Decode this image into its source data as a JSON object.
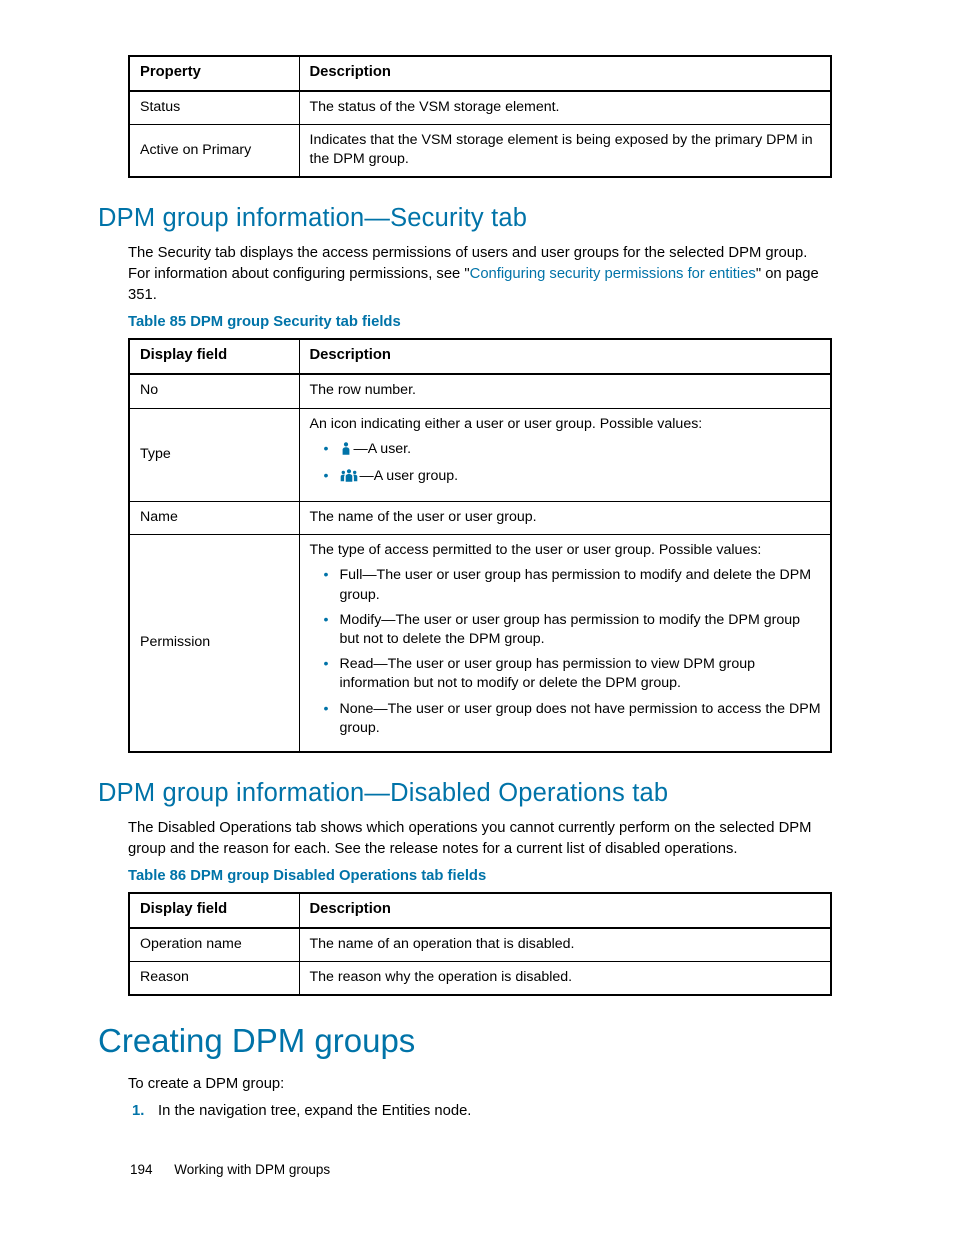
{
  "table1": {
    "headers": [
      "Property",
      "Description"
    ],
    "rows": [
      {
        "k": "Status",
        "v": "The status of the VSM storage element."
      },
      {
        "k": "Active on Primary",
        "v": "Indicates that the VSM storage element is being exposed by the primary DPM in the DPM group."
      }
    ]
  },
  "sec1": {
    "title": "DPM group information—Security tab",
    "intro_a": "The Security tab displays the access permissions of users and user groups for the selected DPM group. For information about configuring permissions, see \"",
    "link": "Configuring security permissions for entities",
    "intro_b": "\" on page 351.",
    "caption": "Table 85 DPM group Security tab fields"
  },
  "table2": {
    "headers": [
      "Display field",
      "Description"
    ],
    "row_no": {
      "k": "No",
      "v": "The row number."
    },
    "row_type": {
      "k": "Type",
      "lead": "An icon indicating either a user or user group. Possible values:",
      "li_user": "—A user.",
      "li_group": "—A user group."
    },
    "row_name": {
      "k": "Name",
      "v": "The name of the user or user group."
    },
    "row_perm": {
      "k": "Permission",
      "lead": "The type of access permitted to the user or user group. Possible values:",
      "items": [
        "Full—The user or user group has permission to modify and delete the DPM group.",
        "Modify—The user or user group has permission to modify the DPM group but not to delete the DPM group.",
        "Read—The user or user group has permission to view DPM group information but not to modify or delete the DPM group.",
        "None—The user or user group does not have permission to access the DPM group."
      ]
    }
  },
  "sec2": {
    "title": "DPM group information—Disabled Operations tab",
    "intro": "The Disabled Operations tab shows which operations you cannot currently perform on the selected DPM group and the reason for each. See the release notes for a current list of disabled operations.",
    "caption": "Table 86 DPM group Disabled Operations tab fields"
  },
  "table3": {
    "headers": [
      "Display field",
      "Description"
    ],
    "rows": [
      {
        "k": "Operation name",
        "v": "The name of an operation that is disabled."
      },
      {
        "k": "Reason",
        "v": "The reason why the operation is disabled."
      }
    ]
  },
  "sec3": {
    "title": "Creating DPM groups",
    "lead": "To create a DPM group:",
    "step1": "In the navigation tree, expand the Entities node."
  },
  "footer": {
    "page": "194",
    "chapter": "Working with DPM groups"
  }
}
